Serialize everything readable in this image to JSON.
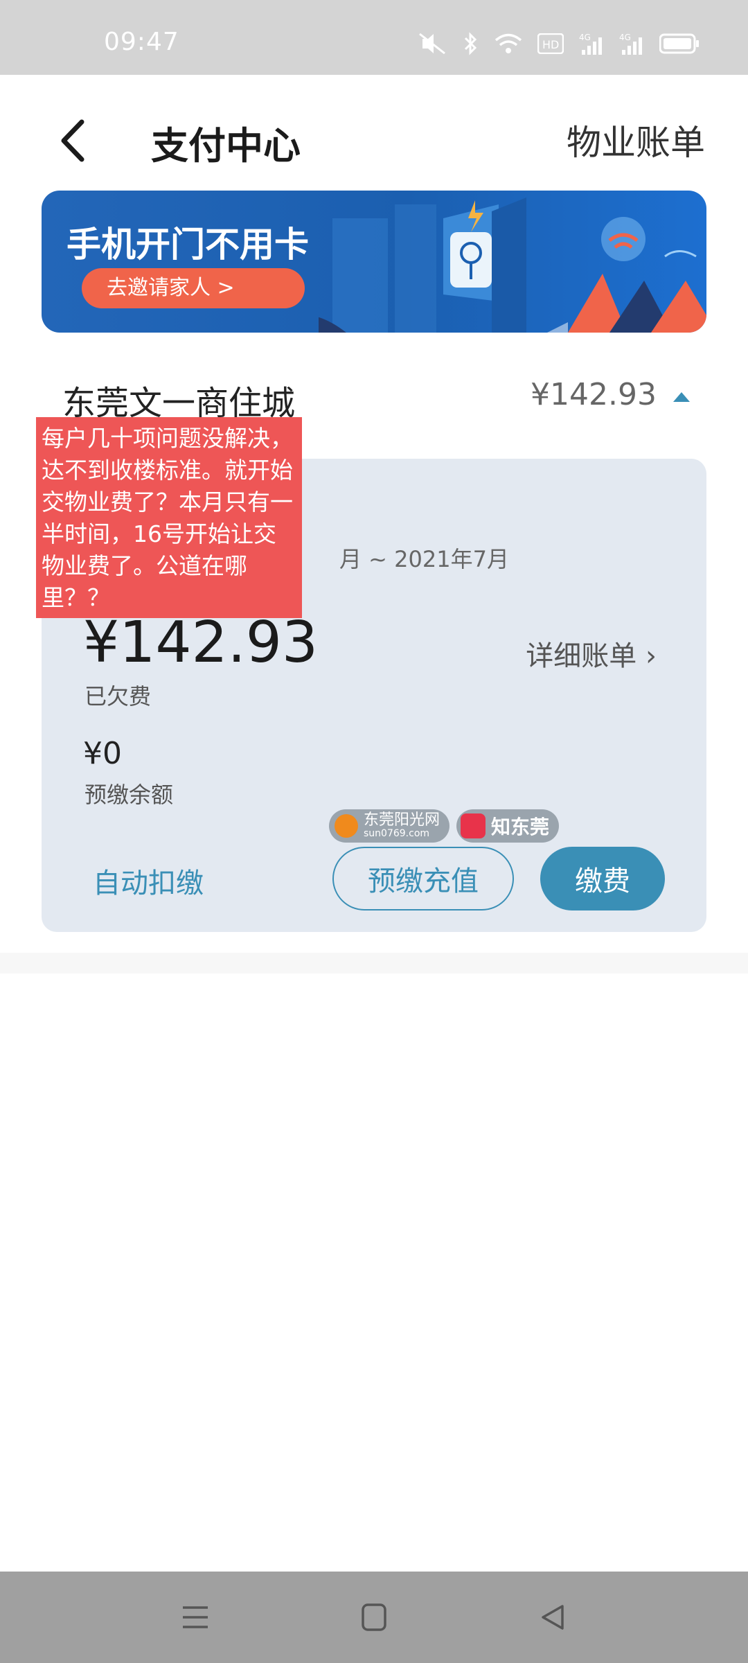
{
  "status_bar": {
    "time": "09:47",
    "icons": [
      "mute-icon",
      "bluetooth-icon",
      "wifi-icon",
      "hd-icon",
      "signal-4g-icon",
      "signal-4g-icon",
      "battery-icon"
    ]
  },
  "header": {
    "title": "支付中心",
    "right_link": "物业账单"
  },
  "banner": {
    "title": "手机开门不用卡",
    "button": "去邀请家人 >"
  },
  "property": {
    "name": "东莞文一商住城",
    "amount": "¥142.93"
  },
  "bill": {
    "period": "月 ~ 2021年7月",
    "arrears_amount": "¥142.93",
    "arrears_label": "已欠费",
    "detail_link": "详细账单 ›",
    "prepay_amount": "¥0",
    "prepay_label": "预缴余额",
    "auto_deduct": "自动扣缴",
    "recharge_button": "预缴充值",
    "pay_button": "缴费"
  },
  "overlay_note": "每户几十项问题没解决，达不到收楼标准。就开始交物业费了？本月只有一半时间，16号开始让交物业费了。公道在哪里？？",
  "watermark": {
    "site1": "东莞阳光网",
    "site1_url": "sun0769.com",
    "site2": "知东莞"
  },
  "colors": {
    "accent": "#3a8fb6",
    "banner_bg": "#1b5fb0",
    "note_bg": "#ee5656"
  }
}
